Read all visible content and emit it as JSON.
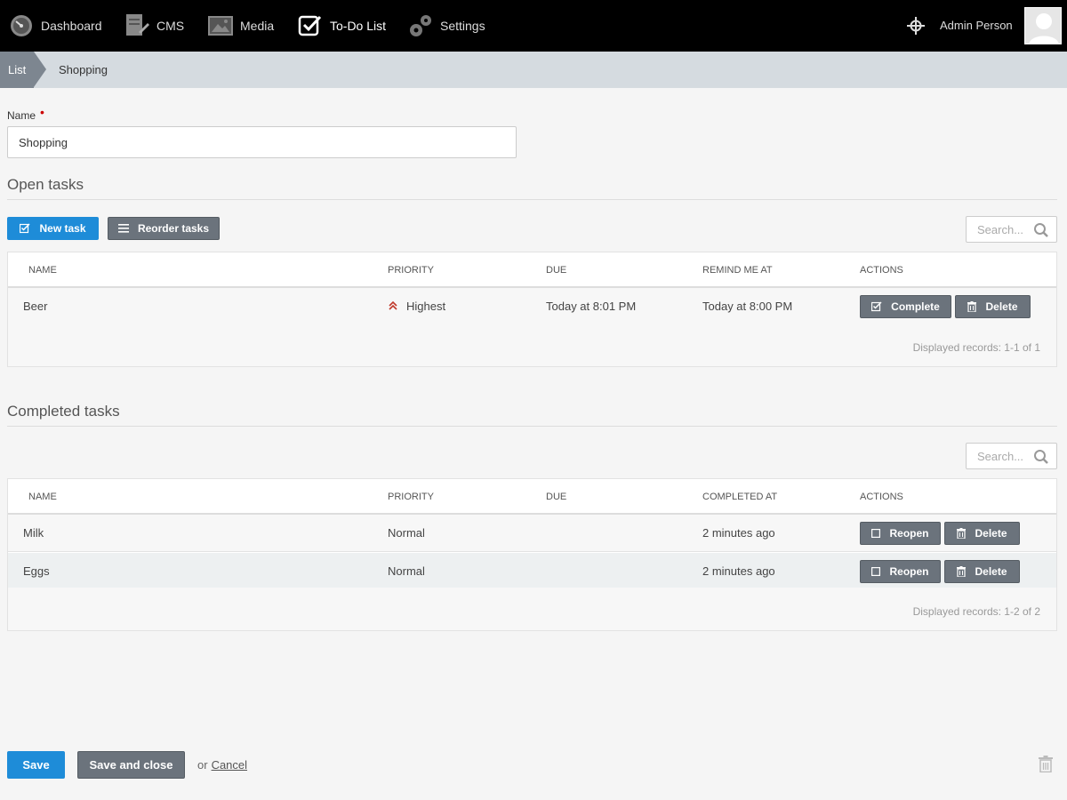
{
  "nav": {
    "items": [
      {
        "label": "Dashboard",
        "icon": "speedometer-icon"
      },
      {
        "label": "CMS",
        "icon": "cms-icon"
      },
      {
        "label": "Media",
        "icon": "media-icon"
      },
      {
        "label": "To-Do List",
        "icon": "checkbox-icon",
        "active": true
      },
      {
        "label": "Settings",
        "icon": "gears-icon"
      }
    ],
    "user_name": "Admin Person"
  },
  "breadcrumb": {
    "root": "List",
    "current": "Shopping"
  },
  "form": {
    "name_label": "Name",
    "required_marker": "•",
    "name_value": "Shopping"
  },
  "open_tasks": {
    "title": "Open tasks",
    "new_task_label": "New task",
    "reorder_label": "Reorder tasks",
    "search_placeholder": "Search...",
    "columns": [
      "NAME",
      "PRIORITY",
      "DUE",
      "REMIND ME AT",
      "ACTIONS"
    ],
    "rows": [
      {
        "name": "Beer",
        "priority": "Highest",
        "due": "Today at 8:01 PM",
        "remind": "Today at 8:00 PM",
        "action1": "Complete",
        "action2": "Delete"
      }
    ],
    "footer": "Displayed records: 1-1 of 1"
  },
  "completed_tasks": {
    "title": "Completed tasks",
    "search_placeholder": "Search...",
    "columns": [
      "NAME",
      "PRIORITY",
      "DUE",
      "COMPLETED AT",
      "ACTIONS"
    ],
    "rows": [
      {
        "name": "Milk",
        "priority": "Normal",
        "due": "",
        "completed": "2 minutes ago",
        "action1": "Reopen",
        "action2": "Delete"
      },
      {
        "name": "Eggs",
        "priority": "Normal",
        "due": "",
        "completed": "2 minutes ago",
        "action1": "Reopen",
        "action2": "Delete"
      }
    ],
    "footer": "Displayed records: 1-2 of 2"
  },
  "bottom": {
    "save_label": "Save",
    "save_close_label": "Save and close",
    "or_text": "or",
    "cancel_label": "Cancel"
  },
  "colors": {
    "primary": "#1e8cd8",
    "gray_button": "#6b737c",
    "topbar": "#000000",
    "breadcrumb_bg": "#d5dbe0",
    "priority_highest": "#c0392b"
  }
}
